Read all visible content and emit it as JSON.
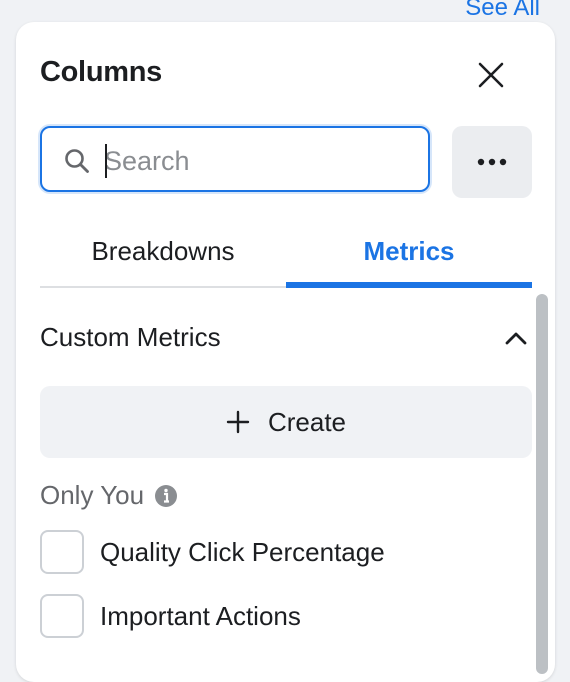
{
  "top_link": {
    "see_all": "See All"
  },
  "panel": {
    "title": "Columns",
    "search": {
      "placeholder": "Search",
      "value": ""
    },
    "tabs": [
      {
        "label": "Breakdowns",
        "active": false
      },
      {
        "label": "Metrics",
        "active": true
      }
    ],
    "section": {
      "title": "Custom Metrics",
      "create_label": "Create",
      "group_label": "Only You",
      "items": [
        {
          "label": "Quality Click Percentage",
          "checked": false
        },
        {
          "label": "Important Actions",
          "checked": false
        }
      ]
    }
  },
  "colors": {
    "accent": "#1b74e4",
    "text": "#1c1e21",
    "muted": "#65676b",
    "button_bg": "#f0f2f5"
  },
  "icons": [
    "close-icon",
    "search-icon",
    "more-icon",
    "chevron-up-icon",
    "plus-icon",
    "info-icon"
  ]
}
